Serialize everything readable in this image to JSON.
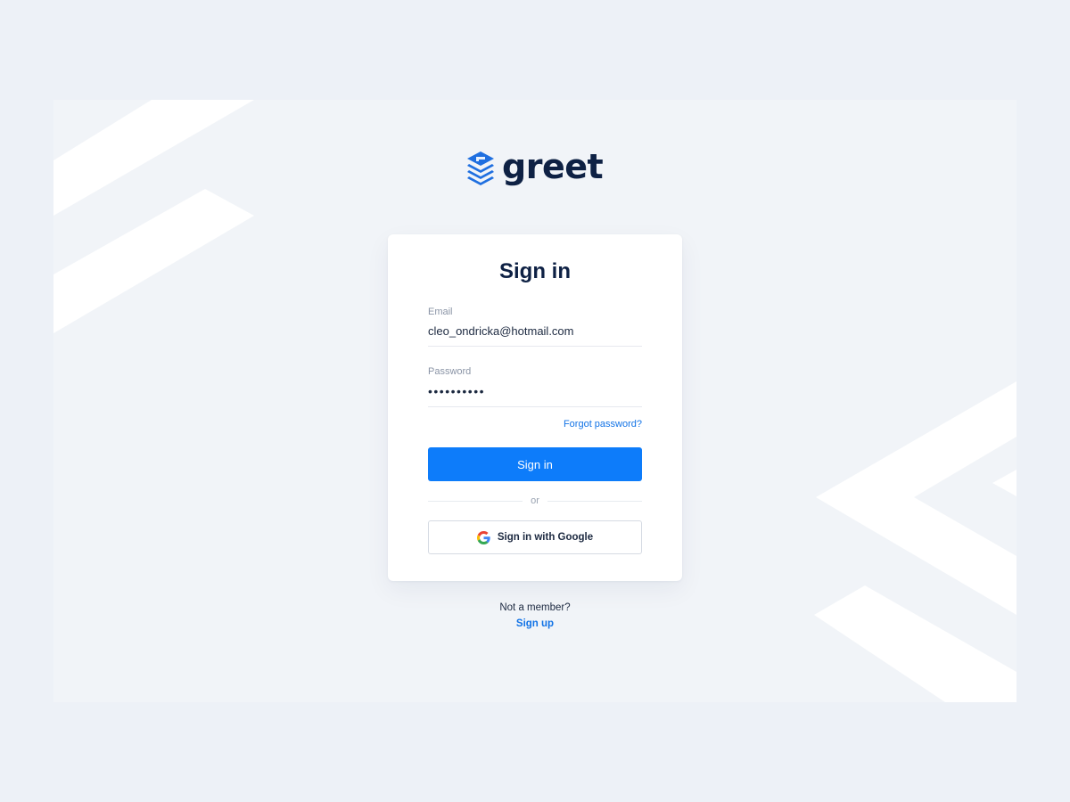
{
  "brand": {
    "name": "greet",
    "logo_icon": "layers-icon",
    "primary_color": "#0d7cfa",
    "text_color": "#0e2144"
  },
  "signin": {
    "title": "Sign in",
    "email": {
      "label": "Email",
      "value": "cleo_ondricka@hotmail.com"
    },
    "password": {
      "label": "Password",
      "value": "••••••••••"
    },
    "forgot_label": "Forgot password?",
    "submit_label": "Sign in",
    "divider_label": "or",
    "google": {
      "label": "Sign in with Google",
      "icon": "google-icon"
    }
  },
  "footer": {
    "prompt": "Not a member?",
    "signup_label": "Sign up"
  }
}
